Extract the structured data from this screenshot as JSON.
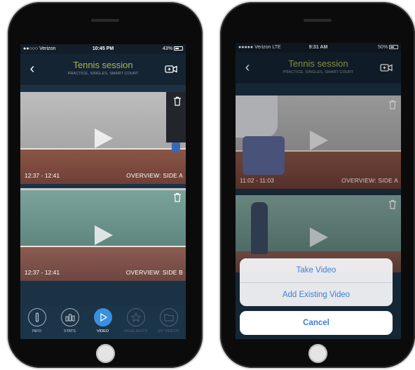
{
  "phones": [
    {
      "status": {
        "carrier": "●●○○○ Verizon ",
        "time": "10:45 PM",
        "battery": "43%"
      },
      "nav": {
        "title": "Tennis session",
        "subtitle": "PRACTICE, SINGLES, SMART COURT"
      },
      "videos": [
        {
          "time_range": "12:37 - 12:41",
          "label": "OVERVIEW: SIDE A"
        },
        {
          "time_range": "12:37 - 12:41",
          "label": "OVERVIEW: SIDE B"
        }
      ],
      "tabs": [
        {
          "label": "INFO",
          "icon": "info-icon"
        },
        {
          "label": "STATS",
          "icon": "stats-icon"
        },
        {
          "label": "VIDEO",
          "icon": "play-icon"
        },
        {
          "label": "HIGHLIGHTS",
          "icon": "star-icon"
        },
        {
          "label": "MY VIDEOS",
          "icon": "folder-icon"
        }
      ],
      "active_tab": "VIDEO"
    },
    {
      "status": {
        "carrier": "●●●●● Verizon  LTE",
        "time": "9:31 AM",
        "battery": "50%"
      },
      "nav": {
        "title": "Tennis session",
        "subtitle": "PRACTICE, SINGLES, SMART COURT"
      },
      "videos": [
        {
          "time_range": "11:02 - 11:03",
          "label": "OVERVIEW: SIDE A"
        },
        {
          "time_range": "",
          "label": ""
        }
      ],
      "action_sheet": {
        "options": [
          "Take Video",
          "Add Existing Video"
        ],
        "cancel": "Cancel"
      }
    }
  ],
  "colors": {
    "title_accent": "#a9b850",
    "active_tab": "#3a8fe0",
    "sheet_text": "#3b7fd6"
  }
}
